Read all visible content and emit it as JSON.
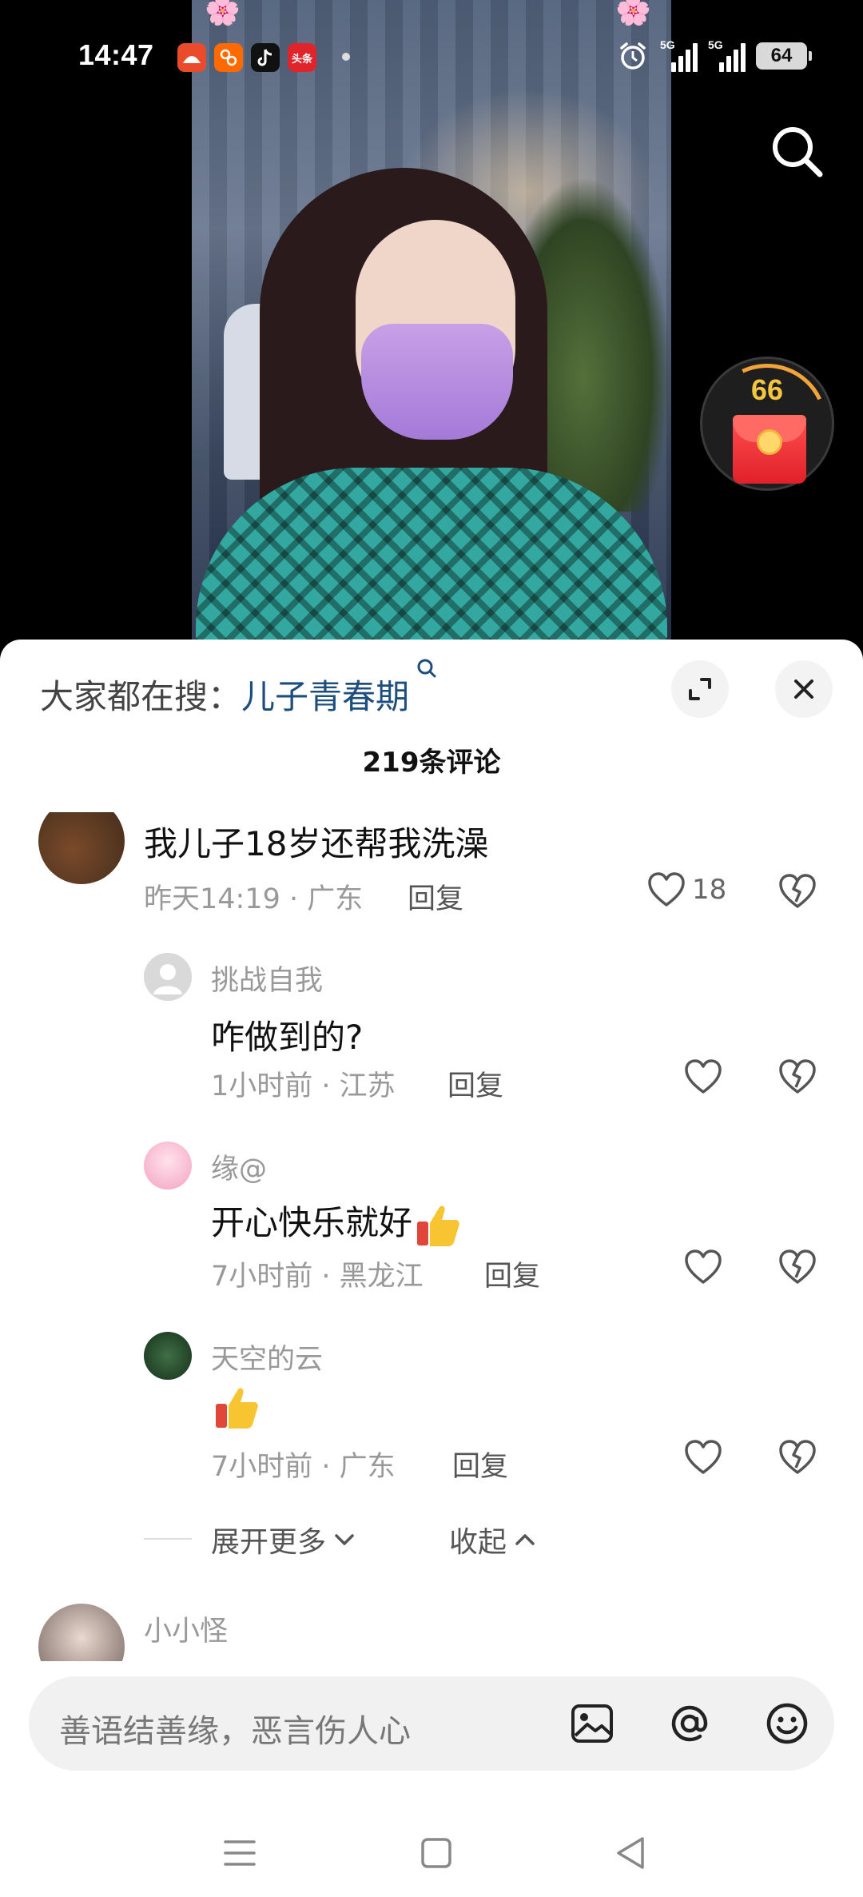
{
  "status_bar": {
    "time": "14:47",
    "apps": [
      {
        "name": "red-app",
        "label": "",
        "color": "#e94b2b"
      },
      {
        "name": "taobao-app",
        "label": "",
        "color": "#ff6a00"
      },
      {
        "name": "douyin-app",
        "label": "",
        "color": "#111111"
      },
      {
        "name": "toutiao-app",
        "label": "头条",
        "color": "#e0242b"
      }
    ],
    "signal1_label": "5G",
    "signal2_label": "5G",
    "battery": "64"
  },
  "overlay": {
    "red_packet_count": "66"
  },
  "sheet": {
    "trending_prefix": "大家都在搜：",
    "trending_term": "儿子青春期",
    "comment_count": "219条评论",
    "comments": [
      {
        "text": "我儿子18岁还帮我洗澡",
        "meta": "昨天14:19 · 广东",
        "reply": "回复",
        "likes": "18"
      }
    ],
    "replies": [
      {
        "user": "挑战自我",
        "text": "咋做到的?",
        "meta": "1小时前 · 江苏",
        "reply": "回复"
      },
      {
        "user": "缘@",
        "text": "开心快乐就好",
        "meta": "7小时前 · 黑龙江",
        "reply": "回复"
      },
      {
        "user": "天空的云",
        "text": "",
        "meta": "7小时前 · 广东",
        "reply": "回复"
      }
    ],
    "expand_more": "展开更多",
    "collapse": "收起",
    "next_user": "小小怪"
  },
  "input": {
    "placeholder": "善语结善缘，恶言伤人心"
  },
  "colors": {
    "accent_link": "#1d4e7e",
    "red_packet": "#e0202a",
    "thumb_yellow": "#f7c531"
  },
  "icons": [
    "search-icon",
    "expand-icon",
    "close-icon",
    "heart-icon",
    "broken-heart-icon",
    "image-icon",
    "at-icon",
    "emoji-icon",
    "menu-icon",
    "home-icon",
    "back-icon",
    "thumbs-up-icon"
  ]
}
